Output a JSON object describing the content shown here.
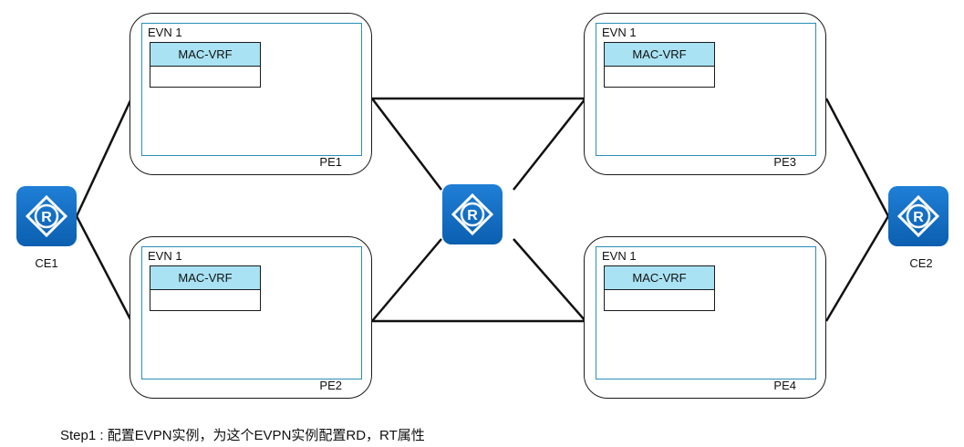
{
  "pe_nodes": [
    {
      "id": "pe1",
      "label": "PE1",
      "evn_label": "EVN 1",
      "vrf_label": "MAC-VRF"
    },
    {
      "id": "pe2",
      "label": "PE2",
      "evn_label": "EVN 1",
      "vrf_label": "MAC-VRF"
    },
    {
      "id": "pe3",
      "label": "PE3",
      "evn_label": "EVN 1",
      "vrf_label": "MAC-VRF"
    },
    {
      "id": "pe4",
      "label": "PE4",
      "evn_label": "EVN 1",
      "vrf_label": "MAC-VRF"
    }
  ],
  "routers": {
    "ce1": {
      "label": "CE1"
    },
    "p": {
      "label": ""
    },
    "ce2": {
      "label": "CE2"
    }
  },
  "step_text": "Step1 : 配置EVPN实例，为这个EVPN实例配置RD，RT属性",
  "colors": {
    "router_blue": "#0b5fb0",
    "vrf_header": "#a8e2f3",
    "evn_border": "#2a8fb5"
  }
}
